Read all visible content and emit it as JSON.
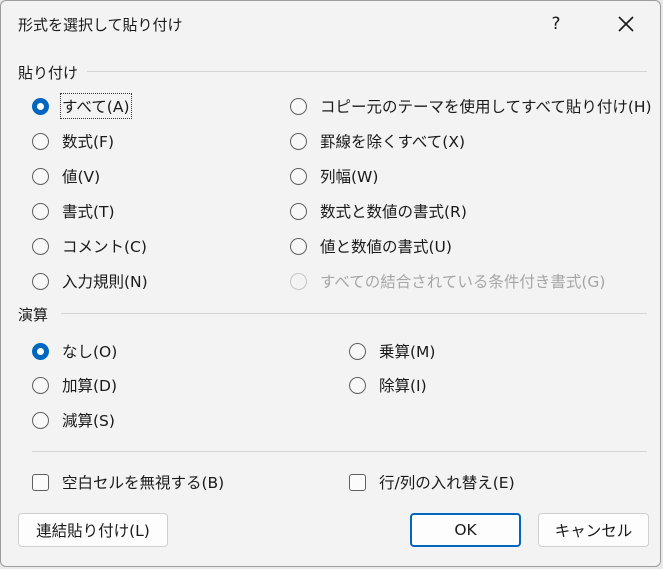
{
  "window": {
    "title": "形式を選択して貼り付け",
    "help_label": "?"
  },
  "paste_section": {
    "label": "貼り付け",
    "options": [
      {
        "label": "すべて(A)",
        "checked": true
      },
      {
        "label": "数式(F)",
        "checked": false
      },
      {
        "label": "値(V)",
        "checked": false
      },
      {
        "label": "書式(T)",
        "checked": false
      },
      {
        "label": "コメント(C)",
        "checked": false
      },
      {
        "label": "入力規則(N)",
        "checked": false
      },
      {
        "label": "コピー元のテーマを使用してすべて貼り付け(H)",
        "checked": false
      },
      {
        "label": "罫線を除くすべて(X)",
        "checked": false
      },
      {
        "label": "列幅(W)",
        "checked": false
      },
      {
        "label": "数式と数値の書式(R)",
        "checked": false
      },
      {
        "label": "値と数値の書式(U)",
        "checked": false
      },
      {
        "label": "すべての結合されている条件付き書式(G)",
        "checked": false,
        "disabled": true
      }
    ]
  },
  "operation_section": {
    "label": "演算",
    "options": [
      {
        "label": "なし(O)",
        "checked": true
      },
      {
        "label": "加算(D)",
        "checked": false
      },
      {
        "label": "減算(S)",
        "checked": false
      },
      {
        "label": "乗算(M)",
        "checked": false
      },
      {
        "label": "除算(I)",
        "checked": false
      }
    ]
  },
  "checkboxes": {
    "skip_blanks": {
      "label": "空白セルを無視する(B)",
      "checked": false
    },
    "transpose": {
      "label": "行/列の入れ替え(E)",
      "checked": false
    }
  },
  "buttons": {
    "paste_link": "連結貼り付け(L)",
    "ok": "OK",
    "cancel": "キャンセル"
  },
  "colors": {
    "accent": "#0067c0",
    "dialog_bg": "#f3f3f3"
  }
}
